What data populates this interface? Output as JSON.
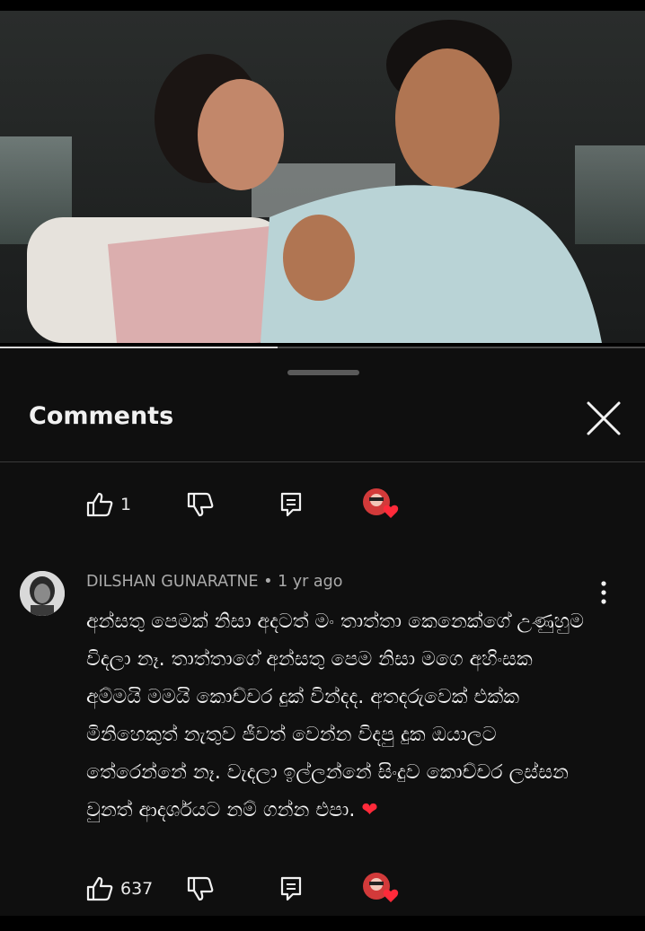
{
  "video": {
    "progress_fraction": 0.43
  },
  "comments_panel": {
    "title": "Comments",
    "top_actions": {
      "like_count": "1"
    },
    "comment": {
      "author": "DILSHAN GUNARATNE",
      "separator": " • ",
      "time": "1 yr ago",
      "text": "අන්සතු පෙමක් නිසා අදටත් මං තාත්තා කෙනෙක්ගේ උණුහුම විදලා නෑ. තාත්තාගේ අන්සතු පෙම නිසා මගෙ අහිංසක අම්මයි මමයි කොච්චර දුක් වින්දද. අතදරුවෙක් එක්ක මිනිහෙකුත් නැතුව ජීවත් වෙන්න විදපු දුක ඔයාලට තේරෙන්නේ නෑ. වැදලා ඉල්ලන්නේ සිංදුව කොච්චර ලස්සන වුනත් ආදර්ශයට නම් ගන්න එපා. ",
      "heart": "❤",
      "like_count": "637"
    }
  },
  "colors": {
    "background": "#0f0f0f",
    "meta_text": "#aaaaaa",
    "heart": "#ff2a3a"
  },
  "icons": [
    "thumbs-up-icon",
    "thumbs-down-icon",
    "reply-icon",
    "creator-heart-icon",
    "close-icon",
    "more-vert-icon"
  ]
}
